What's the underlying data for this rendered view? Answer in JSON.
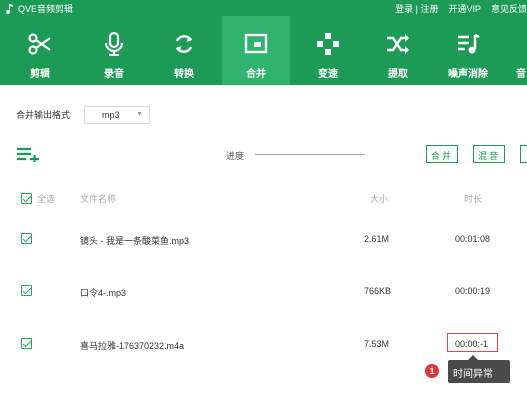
{
  "app": {
    "title": "QVE音频剪辑"
  },
  "header_links": {
    "login": "登录 | 注册",
    "vip": "开通VIP",
    "feedback": "意见反馈"
  },
  "toolbar": {
    "tools": [
      {
        "label": "剪辑",
        "icon": "scissors-icon"
      },
      {
        "label": "录音",
        "icon": "microphone-icon"
      },
      {
        "label": "转换",
        "icon": "convert-icon"
      },
      {
        "label": "合并",
        "icon": "merge-icon",
        "active": true
      },
      {
        "label": "变速",
        "icon": "speed-icon"
      },
      {
        "label": "提取",
        "icon": "extract-icon"
      },
      {
        "label": "噪声消除",
        "icon": "noise-icon"
      },
      {
        "label": "音"
      }
    ]
  },
  "options": {
    "format_label": "合并输出格式",
    "format_value": "mp3"
  },
  "controls": {
    "progress_label": "进度",
    "merge_button": "合并",
    "mix_button": "混音"
  },
  "table": {
    "select_all": "全选",
    "columns": {
      "name": "文件名称",
      "size": "大小",
      "duration": "时长"
    },
    "rows": [
      {
        "name": "镜头 - 我是一条酸菜鱼.mp3",
        "size": "2.61M",
        "duration": "00:01:08"
      },
      {
        "name": "口令4-.mp3",
        "size": "766KB",
        "duration": "00:00:19"
      },
      {
        "name": "喜马拉雅-176370232.m4a",
        "size": "7.53M",
        "duration": "00:00:-1"
      }
    ]
  },
  "warning": {
    "badge": "1",
    "text": "时间异常"
  },
  "colors": {
    "brand": "#1e9a57",
    "active_tab": "#2fb36d",
    "error": "#e34848"
  }
}
